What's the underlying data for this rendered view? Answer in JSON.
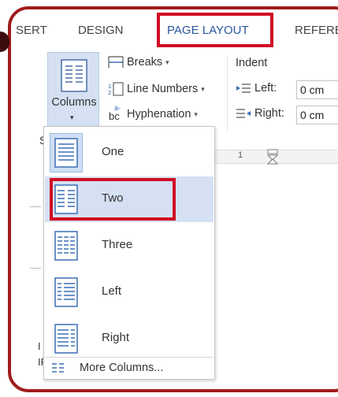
{
  "tabs": [
    {
      "label": "SERT",
      "active": false
    },
    {
      "label": "DESIGN",
      "active": false
    },
    {
      "label": "PAGE LAYOUT",
      "active": true
    },
    {
      "label": "REFERE",
      "active": false
    }
  ],
  "ribbon": {
    "columns_label": "Columns",
    "breaks_label": "Breaks",
    "line_numbers_label": "Line Numbers",
    "hyphenation_label": "Hyphenation",
    "hyphenation_glyph": "bc",
    "hyphenation_sup": "a-",
    "dropdown_caret": "▾",
    "launcher_glyph": "↘",
    "group_letter": "S",
    "indent": {
      "title": "Indent",
      "left_label": "Left:",
      "left_value": "0 cm",
      "right_label": "Right:",
      "right_value": "0 cm"
    }
  },
  "ruler": {
    "number": "1"
  },
  "columns_menu": {
    "options": [
      {
        "label": "One",
        "icon": "one-column-icon"
      },
      {
        "label": "Two",
        "icon": "two-columns-icon"
      },
      {
        "label": "Three",
        "icon": "three-columns-icon"
      },
      {
        "label": "Left",
        "icon": "left-columns-icon"
      },
      {
        "label": "Right",
        "icon": "right-columns-icon"
      }
    ],
    "current": "One",
    "hovered": "Two",
    "more_label": "More Columns..."
  },
  "side_letters": [
    "I",
    "IF"
  ],
  "colors": {
    "accent_blue": "#2b579a",
    "highlight_red": "#d10c24",
    "frame_red": "#a01c1c",
    "selection_blue": "#d5e1f2"
  }
}
